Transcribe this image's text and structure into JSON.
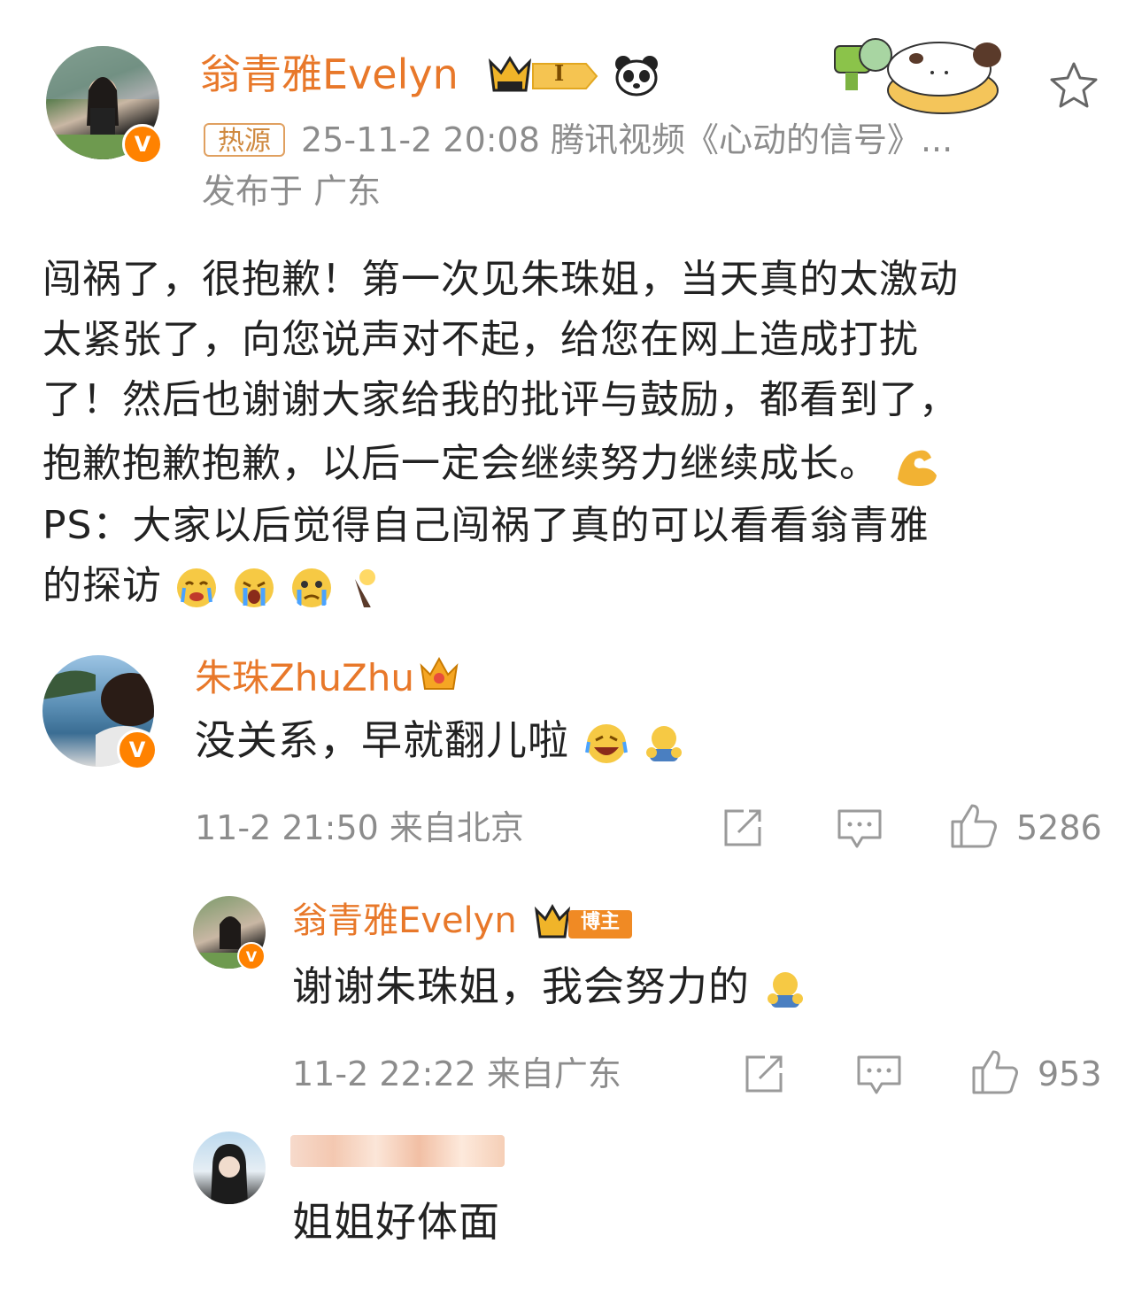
{
  "post": {
    "author": "翁青雅Evelyn",
    "level_badge": "I",
    "hot_tag": "热源",
    "time_source": "25-11-2 20:08  腾讯视频《心动的信号》...",
    "location": "发布于 广东",
    "body_lines": [
      "闯祸了，很抱歉！第一次见朱珠姐，当天真的太激动",
      "太紧张了，向您说声对不起，给您在网上造成打扰",
      "了！然后也谢谢大家给我的批评与鼓励，都看到了，",
      "抱歉抱歉抱歉，以后一定会继续努力继续成长。",
      "PS：大家以后觉得自己闯祸了真的可以看看翁青雅",
      "的探访"
    ]
  },
  "comment1": {
    "author": "朱珠ZhuZhu",
    "text": "没关系，早就翻儿啦",
    "meta": "11-2 21:50 来自北京",
    "likes": "5286"
  },
  "reply1": {
    "author": "翁青雅Evelyn",
    "badge": "博主",
    "text": "谢谢朱珠姐，我会努力的",
    "meta": "11-2 22:22 来自广东",
    "likes": "953"
  },
  "reply2": {
    "text": "姐姐好体面"
  },
  "colors": {
    "username": "#e8782a",
    "verified": "#ff8200",
    "meta_gray": "#8c8c8c",
    "icon_gray": "#9a9a9a"
  }
}
